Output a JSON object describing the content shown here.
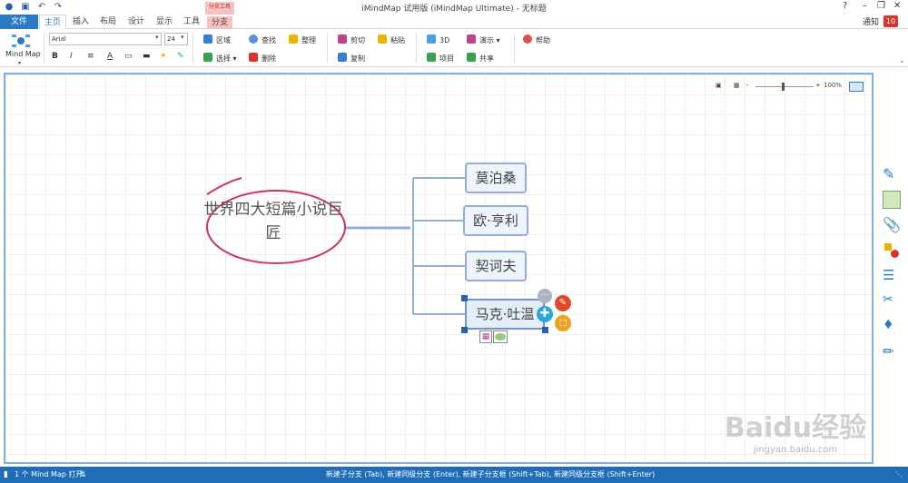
{
  "window": {
    "title": "iMindMap 试用版 (iMindMap Ultimate) - 无标题",
    "help": "?",
    "notice_label": "通知",
    "notice_count": "10"
  },
  "tabs": [
    {
      "label": "文件"
    },
    {
      "label": "主页"
    },
    {
      "label": "插入"
    },
    {
      "label": "布局"
    },
    {
      "label": "设计"
    },
    {
      "label": "显示"
    },
    {
      "label": "工具"
    },
    {
      "label": "分支"
    }
  ],
  "context_tab_group": "分支工具",
  "ribbon": {
    "mindmap_label": "Mind Map",
    "font_name": "Arial",
    "font_size": "24",
    "format_buttons": [
      "B",
      "I"
    ],
    "area": "区域",
    "select": "选择",
    "find": "查找",
    "delete": "删除",
    "tidy": "整理",
    "cut": "剪切",
    "copy": "复制",
    "paste": "粘贴",
    "three_d": "3D",
    "project": "项目",
    "present": "演示",
    "share": "共享",
    "help": "帮助"
  },
  "zoom": {
    "value": "100%",
    "minus": "-",
    "plus": "+"
  },
  "map": {
    "central": "世界四大短篇小说巨匠",
    "branches": [
      "莫泊桑",
      "欧·亨利",
      "契诃夫",
      "马克·吐温"
    ]
  },
  "statusbar": {
    "open_count": "1 个 Mind Map 打开",
    "hint": "新建子分支 (Tab), 新建同级分支 (Enter), 新建子分支框 (Shift+Tab), 新建同级分支框 (Shift+Enter)"
  },
  "watermark": {
    "brand": "Baidu经验",
    "url": "jingyan.baidu.com"
  },
  "colors": {
    "accent": "#2b79c2",
    "branch_line": "#8fadd8",
    "central_circle": "#d0306a",
    "status_bar": "#1f6cb8"
  }
}
